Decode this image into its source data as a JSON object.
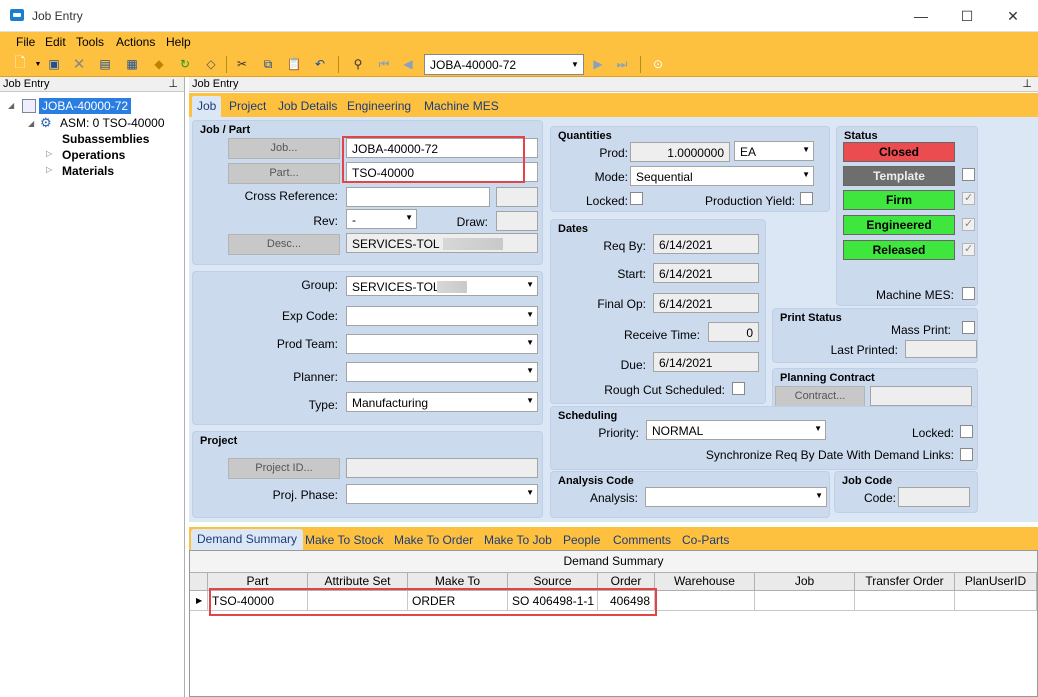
{
  "window": {
    "title": "Job Entry"
  },
  "menu": [
    "File",
    "Edit",
    "Tools",
    "Actions",
    "Help"
  ],
  "toolbar": {
    "job_combo_value": "JOBA-40000-72"
  },
  "left_pane": {
    "title": "Job Entry",
    "tree": {
      "root": "JOBA-40000-72",
      "asm": "ASM: 0 TSO-40000",
      "subassemblies": "Subassemblies",
      "operations": "Operations",
      "materials": "Materials"
    }
  },
  "right_pane": {
    "title": "Job Entry"
  },
  "tabs": [
    "Job",
    "Project",
    "Job Details",
    "Engineering",
    "Machine MES"
  ],
  "job_part": {
    "title": "Job / Part",
    "job_button": "Job...",
    "job_value": "JOBA-40000-72",
    "part_button": "Part...",
    "part_value": "TSO-40000",
    "cross_reference_label": "Cross Reference:",
    "rev_label": "Rev:",
    "rev_value": "-",
    "draw_label": "Draw:",
    "desc_button": "Desc...",
    "desc_value": "SERVICES-TOL"
  },
  "classification": {
    "group_label": "Group:",
    "group_value": "SERVICES-TOL",
    "exp_code_label": "Exp Code:",
    "prod_team_label": "Prod Team:",
    "planner_label": "Planner:",
    "type_label": "Type:",
    "type_value": "Manufacturing"
  },
  "project": {
    "title": "Project",
    "project_id_button": "Project ID...",
    "proj_phase_label": "Proj. Phase:"
  },
  "quantities": {
    "title": "Quantities",
    "prod_label": "Prod:",
    "prod_value": "1.0000000",
    "uom_value": "EA",
    "mode_label": "Mode:",
    "mode_value": "Sequential",
    "locked_label": "Locked:",
    "production_yield_label": "Production Yield:"
  },
  "dates": {
    "title": "Dates",
    "req_by_label": "Req By:",
    "req_by_value": "6/14/2021",
    "start_label": "Start:",
    "start_value": "6/14/2021",
    "final_op_label": "Final Op:",
    "final_op_value": "6/14/2021",
    "receive_time_label": "Receive Time:",
    "receive_time_value": "0",
    "due_label": "Due:",
    "due_value": "6/14/2021",
    "rough_cut_label": "Rough Cut Scheduled:"
  },
  "status": {
    "title": "Status",
    "closed": "Closed",
    "template": "Template",
    "firm": "Firm",
    "engineered": "Engineered",
    "released": "Released",
    "machine_mes_label": "Machine MES:",
    "colors": {
      "closed": "#ea4c4f",
      "template": "#6e6e6e",
      "green": "#3ee63e"
    }
  },
  "print_status": {
    "title": "Print Status",
    "mass_print_label": "Mass Print:",
    "last_printed_label": "Last Printed:"
  },
  "planning_contract": {
    "title": "Planning Contract",
    "contract_button": "Contract..."
  },
  "scheduling": {
    "title": "Scheduling",
    "priority_label": "Priority:",
    "priority_value": "NORMAL",
    "locked_label": "Locked:",
    "sync_label": "Synchronize Req By Date With Demand Links:"
  },
  "analysis": {
    "title": "Analysis Code",
    "analysis_label": "Analysis:"
  },
  "job_code": {
    "title": "Job Code",
    "code_label": "Code:"
  },
  "bottom_tabs": [
    "Demand Summary",
    "Make To Stock",
    "Make To Order",
    "Make To Job",
    "People",
    "Comments",
    "Co-Parts"
  ],
  "demand_grid": {
    "title": "Demand Summary",
    "columns": [
      "Part",
      "Attribute Set",
      "Make To",
      "Source",
      "Order",
      "Warehouse",
      "Job",
      "Transfer Order",
      "PlanUserID"
    ],
    "rows": [
      [
        "TSO-40000",
        "",
        "ORDER",
        "SO 406498-1-1",
        "406498",
        "",
        "",
        "",
        ""
      ]
    ]
  }
}
